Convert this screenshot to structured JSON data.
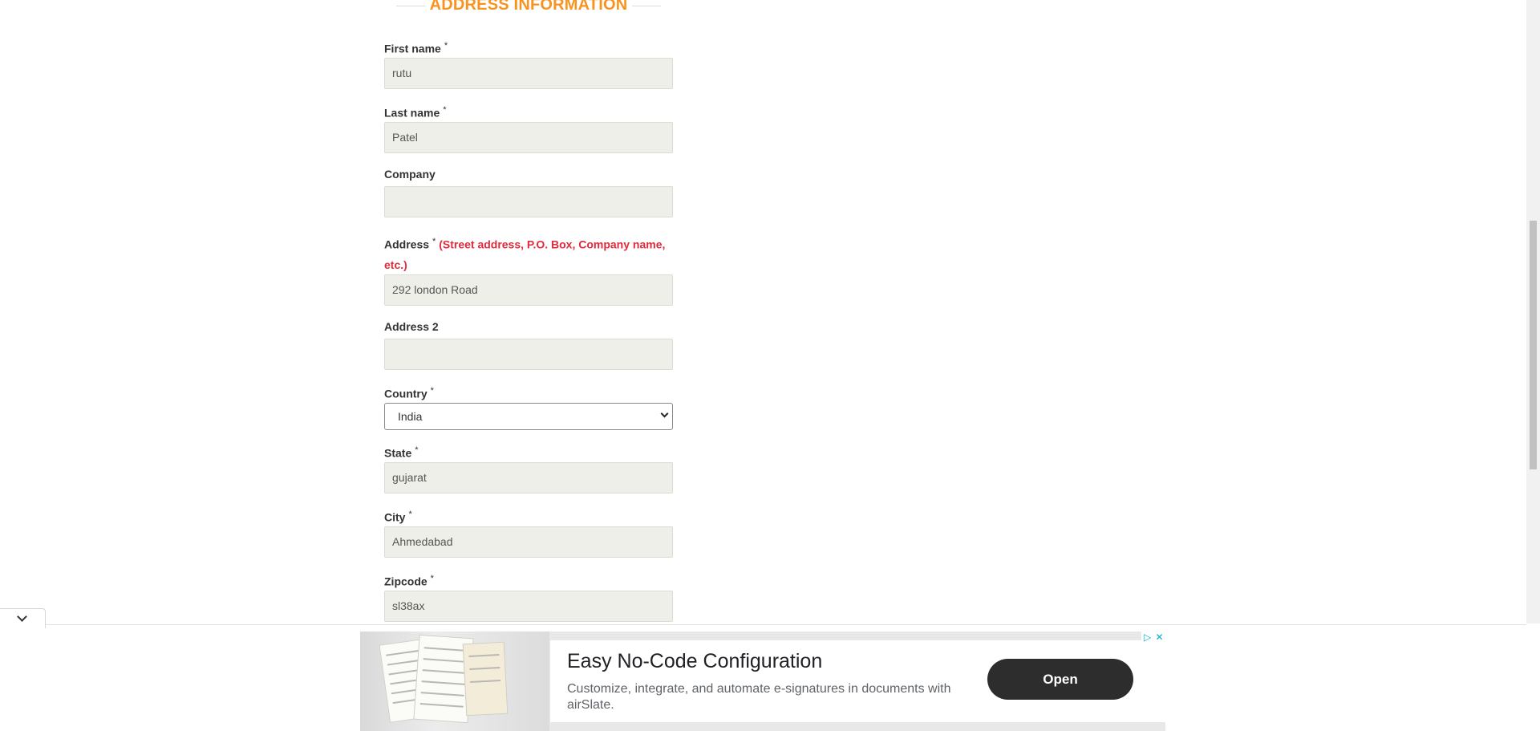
{
  "section": {
    "title": "ADDRESS INFORMATION"
  },
  "required_mark": "*",
  "fields": {
    "first_name": {
      "label": "First name",
      "value": "rutu"
    },
    "last_name": {
      "label": "Last name",
      "value": "Patel"
    },
    "company": {
      "label": "Company",
      "value": ""
    },
    "address": {
      "label": "Address",
      "hint": "(Street address, P.O. Box, Company name,",
      "hint2": "etc.)",
      "value": "292 london Road"
    },
    "address2": {
      "label": "Address 2",
      "value": ""
    },
    "country": {
      "label": "Country",
      "selected": "India"
    },
    "state": {
      "label": "State",
      "value": "gujarat"
    },
    "city": {
      "label": "City",
      "value": "Ahmedabad"
    },
    "zipcode": {
      "label": "Zipcode",
      "value": "sl38ax"
    }
  },
  "ad": {
    "headline": "Easy No-Code Configuration",
    "body": "Customize, integrate, and automate e-signatures in documents with airSlate.",
    "cta": "Open",
    "adchoices_icon": "▷",
    "close_icon": "✕"
  },
  "colors": {
    "accent": "#f7931e",
    "hint": "#e02b3c",
    "field_bg": "#efefe9",
    "cta_bg": "#2d2d2d"
  }
}
